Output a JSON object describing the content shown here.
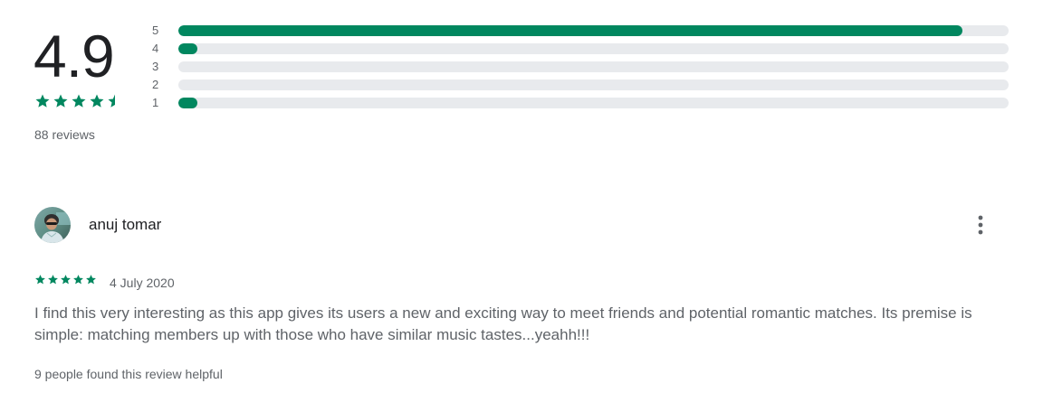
{
  "summary": {
    "average_rating": "4.9",
    "stars_value": 4.9,
    "reviews_count": "88 reviews",
    "accent_color": "#01875f",
    "track_color": "#e8eaed",
    "distribution": [
      {
        "label": "5",
        "fraction": 0.944
      },
      {
        "label": "4",
        "fraction": 0.023
      },
      {
        "label": "3",
        "fraction": 0.0
      },
      {
        "label": "2",
        "fraction": 0.0
      },
      {
        "label": "1",
        "fraction": 0.023
      }
    ]
  },
  "review": {
    "author": "anuj tomar",
    "avatar_icon": "user-avatar-photo",
    "rating": 5,
    "date": "4 July 2020",
    "text": "I find this very interesting as this app gives its users a new and exciting way to meet friends and potential romantic matches. Its premise is simple: matching members up with those who have similar music tastes...yeahh!!!",
    "helpful": "9 people found this review helpful",
    "menu_icon": "more-vert-icon"
  }
}
